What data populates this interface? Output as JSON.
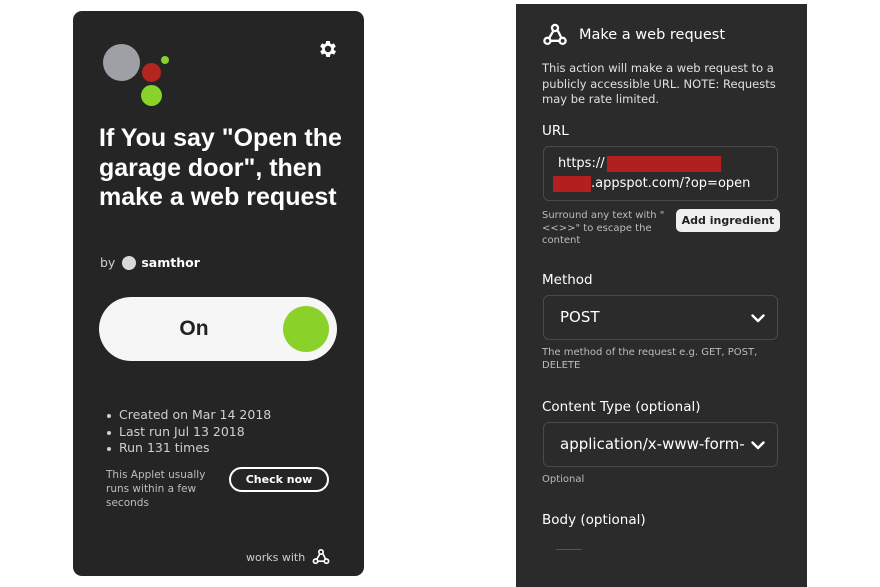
{
  "applet": {
    "title": "If You say \"Open the garage door\", then make a web request",
    "author_prefix": "by",
    "author": "samthor",
    "toggle_label": "On",
    "stats": [
      "Created on Mar 14 2018",
      "Last run Jul 13 2018",
      "Run 131 times"
    ],
    "usually_text": "This Applet usually runs within a few seconds",
    "check_now": "Check now",
    "works_with": "works with",
    "colors": {
      "grey_dot": "#9ea0a6",
      "red_dot": "#b5251f",
      "green_dot": "#8ad12a",
      "card_bg": "#252525"
    },
    "icons": {
      "settings": "gear-icon",
      "service": "webhooks-icon"
    }
  },
  "action": {
    "title": "Make a web request",
    "description": "This action will make a web request to a publicly accessible URL. NOTE: Requests may be rate limited.",
    "url_label": "URL",
    "url_prefix": "https://",
    "url_suffix": ".appspot.com/?op=open",
    "url_hint": "Surround any text with \"<<>>\" to escape the content",
    "add_ingredient": "Add ingredient",
    "method_label": "Method",
    "method_value": "POST",
    "method_hint": "The method of the request e.g. GET, POST, DELETE",
    "content_type_label": "Content Type (optional)",
    "content_type_value": "application/x-www-form-urlencoded",
    "content_type_hint": "Optional",
    "body_label": "Body (optional)",
    "colors": {
      "panel_bg": "#2b2b2b",
      "redaction": "#b21f1f"
    }
  }
}
